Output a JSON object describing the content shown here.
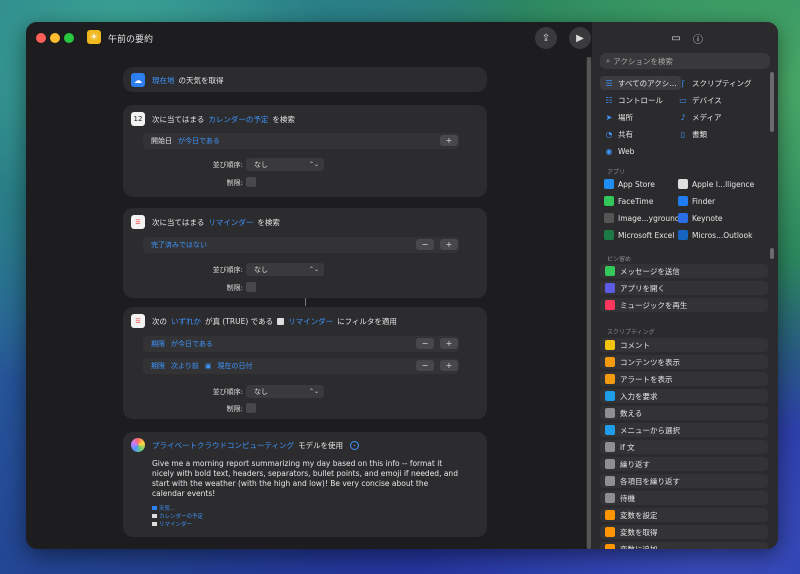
{
  "window": {
    "title": "午前の要約"
  },
  "card1": {
    "token": "現在地",
    "text": "の天気を取得"
  },
  "card2": {
    "prefix": "次に当てはまる",
    "token": "カレンダーの予定",
    "suffix": "を検索",
    "filter_field": "開始日",
    "filter_cond": "が今日である",
    "sort_label": "並び順序:",
    "sort_value": "なし",
    "limit_label": "制限:"
  },
  "card3": {
    "prefix": "次に当てはまる",
    "token": "リマインダー",
    "suffix": "を検索",
    "filter_cond": "完了済みではない",
    "sort_label": "並び順序:",
    "sort_value": "なし",
    "limit_label": "制限:"
  },
  "card4": {
    "p1": "次の",
    "token1": "いずれか",
    "p2": "が真 (TRUE) である",
    "token2": "リマインダー",
    "p3": "にフィルタを適用",
    "f1_field": "期限",
    "f1_cond": "が今日である",
    "f2_field": "期限",
    "f2_cond": "次より前",
    "f2_value": "現在の日付",
    "sort_label": "並び順序:",
    "sort_value": "なし",
    "limit_label": "制限:"
  },
  "card5": {
    "token": "プライベートクラウドコンピューティング",
    "suffix": "モデルを使用",
    "prompt": "Give me a morning report summarizing my day based on this info -- format it nicely with bold text, headers, separators, bullet points, and emoji if needed, and start with the weather (with the high and low)! Be very concise about the calendar events!",
    "att1": "天気...",
    "att2": "カレンダーの予定",
    "att3": "リマインダー"
  },
  "sidebar": {
    "search_placeholder": "アクションを検索",
    "categories": [
      {
        "label": "すべてのアクシ…",
        "icon": "list-icon"
      },
      {
        "label": "スクリプティング",
        "icon": "script-icon"
      },
      {
        "label": "コントロール",
        "icon": "toggle-icon"
      },
      {
        "label": "デバイス",
        "icon": "monitor-icon"
      },
      {
        "label": "場所",
        "icon": "location-icon"
      },
      {
        "label": "メディア",
        "icon": "music-icon"
      },
      {
        "label": "共有",
        "icon": "share-icon"
      },
      {
        "label": "書類",
        "icon": "document-icon"
      },
      {
        "label": "Web",
        "icon": "compass-icon"
      }
    ],
    "apps_title": "アプリ",
    "apps": [
      "App Store",
      "Apple I...lligence",
      "FaceTime",
      "Finder",
      "Image...yground",
      "Keynote",
      "Microsoft Excel",
      "Micros...Outlook"
    ],
    "pinned_title": "ピン留め",
    "pinned": [
      {
        "label": "メッセージを送信",
        "color": "#34c759"
      },
      {
        "label": "アプリを開く",
        "color": "#5e5ce6"
      },
      {
        "label": "ミュージックを再生",
        "color": "#ff375f"
      }
    ],
    "scripting_title": "スクリプティング",
    "scripting": [
      {
        "label": "コメント",
        "color": "#f2c40f"
      },
      {
        "label": "コンテンツを表示",
        "color": "#f39c12"
      },
      {
        "label": "アラートを表示",
        "color": "#f39c12"
      },
      {
        "label": "入力を要求",
        "color": "#1e9ee8"
      },
      {
        "label": "数える",
        "color": "#8e8e93"
      },
      {
        "label": "メニューから選択",
        "color": "#1e9ee8"
      },
      {
        "label": "if 文",
        "color": "#8e8e93"
      },
      {
        "label": "繰り返す",
        "color": "#8e8e93"
      },
      {
        "label": "各項目を繰り返す",
        "color": "#8e8e93"
      },
      {
        "label": "待機",
        "color": "#8e8e93"
      },
      {
        "label": "変数を設定",
        "color": "#ff9500"
      },
      {
        "label": "変数を取得",
        "color": "#ff9500"
      },
      {
        "label": "変数に追加",
        "color": "#ff9500"
      }
    ]
  }
}
